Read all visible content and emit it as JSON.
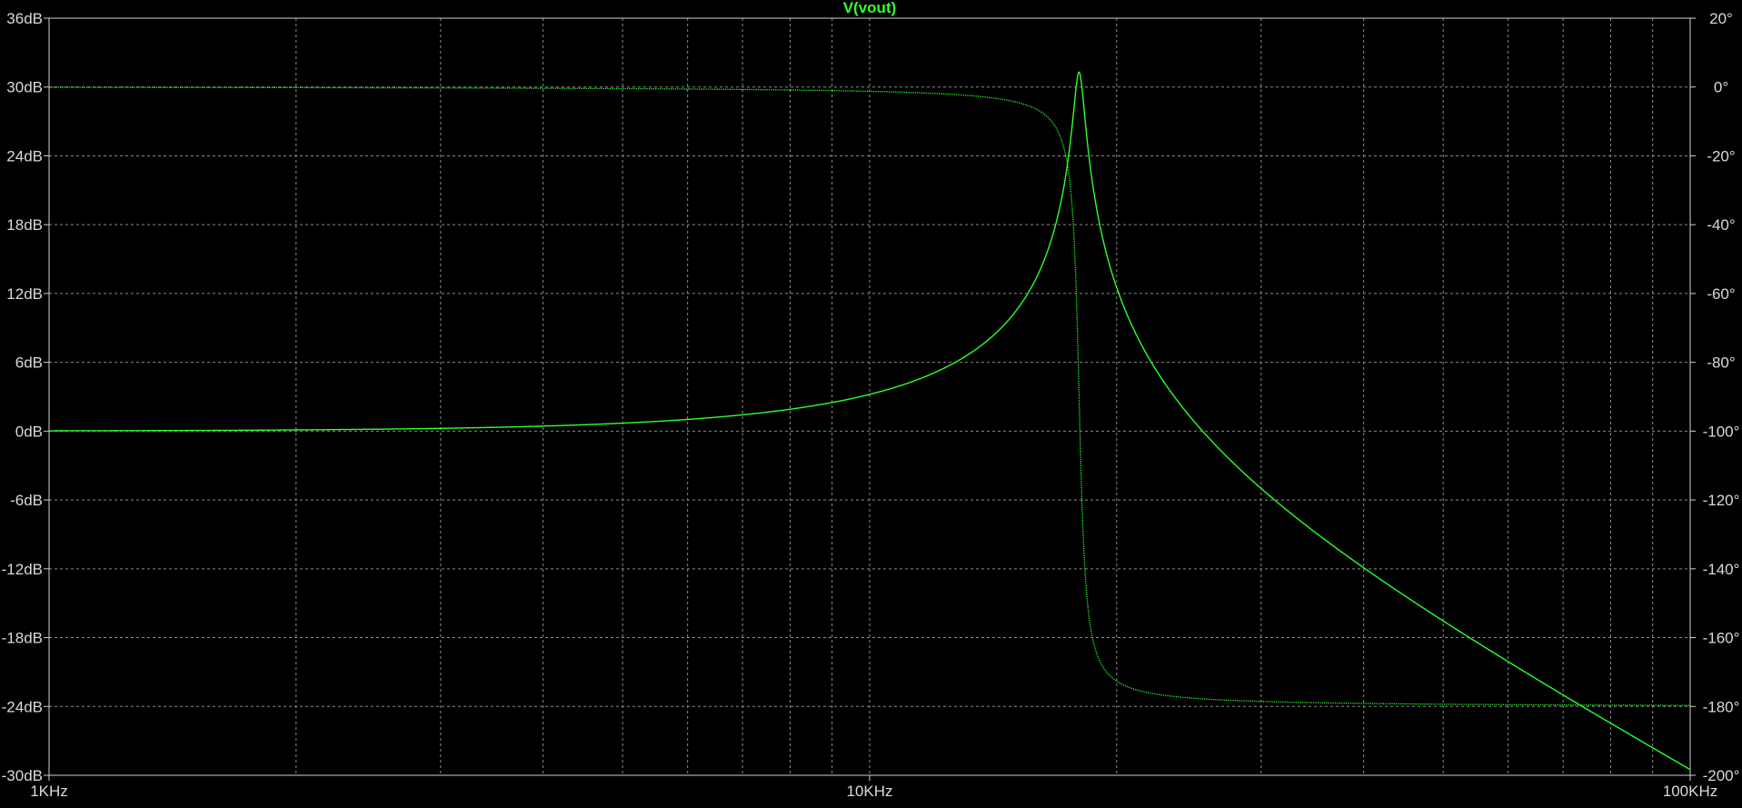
{
  "chart_data": {
    "type": "line",
    "title": "V(vout)",
    "x_scale": "log",
    "xlim": [
      1000,
      100000
    ],
    "x_ticks": [
      {
        "value": 1000,
        "label": "1KHz"
      },
      {
        "value": 10000,
        "label": "10KHz"
      },
      {
        "value": 100000,
        "label": "100KHz"
      }
    ],
    "y_left": {
      "unit": "dB",
      "ylim": [
        -30,
        36
      ],
      "ticks": [
        {
          "value": 36,
          "label": "36dB"
        },
        {
          "value": 30,
          "label": "30dB"
        },
        {
          "value": 24,
          "label": "24dB"
        },
        {
          "value": 18,
          "label": "18dB"
        },
        {
          "value": 12,
          "label": "12dB"
        },
        {
          "value": 6,
          "label": "6dB"
        },
        {
          "value": 0,
          "label": "0dB"
        },
        {
          "value": -6,
          "label": "-6dB"
        },
        {
          "value": -12,
          "label": "-12dB"
        },
        {
          "value": -18,
          "label": "-18dB"
        },
        {
          "value": -24,
          "label": "-24dB"
        },
        {
          "value": -30,
          "label": "-30dB"
        }
      ]
    },
    "y_right": {
      "unit": "°",
      "ylim": [
        -200,
        20
      ],
      "ticks": [
        {
          "value": 20,
          "label": "20°"
        },
        {
          "value": 0,
          "label": "0°"
        },
        {
          "value": -20,
          "label": "-20°"
        },
        {
          "value": -40,
          "label": "-40°"
        },
        {
          "value": -60,
          "label": "-60°"
        },
        {
          "value": -80,
          "label": "-80°"
        },
        {
          "value": -100,
          "label": "-100°"
        },
        {
          "value": -120,
          "label": "-120°"
        },
        {
          "value": -140,
          "label": "-140°"
        },
        {
          "value": -160,
          "label": "-160°"
        },
        {
          "value": -180,
          "label": "-180°"
        },
        {
          "value": -200,
          "label": "-200°"
        }
      ]
    },
    "grid": true,
    "series": [
      {
        "axis": "left",
        "style": "solid",
        "color": "#2bff2b",
        "model": "second-order low-pass magnitude",
        "f0": 18000,
        "peak_db": 31.3,
        "x": [
          1000,
          2000,
          5000,
          10000,
          15000,
          17000,
          18000,
          19000,
          20000,
          25000,
          30000,
          50000,
          100000
        ],
        "y": [
          0,
          0.1,
          0.8,
          3.2,
          10.3,
          19.5,
          31.3,
          19.2,
          13.4,
          2.1,
          -3.3,
          -13.8,
          -29.4
        ]
      },
      {
        "axis": "right",
        "style": "dotted",
        "color": "#2bff2b",
        "model": "second-order low-pass phase",
        "f0": 18000,
        "x": [
          1000,
          5000,
          10000,
          15000,
          17000,
          18000,
          19000,
          20000,
          25000,
          50000,
          100000
        ],
        "y": [
          0,
          -0.3,
          -1,
          -5,
          -15,
          -90,
          -165,
          -173,
          -178,
          -179.5,
          -180
        ]
      }
    ],
    "colors": {
      "background": "#000000",
      "grid": "#8a8a8a",
      "frame": "#cfcfcf",
      "tick_label": "#d9d9d9",
      "title": "#31ff31"
    }
  }
}
